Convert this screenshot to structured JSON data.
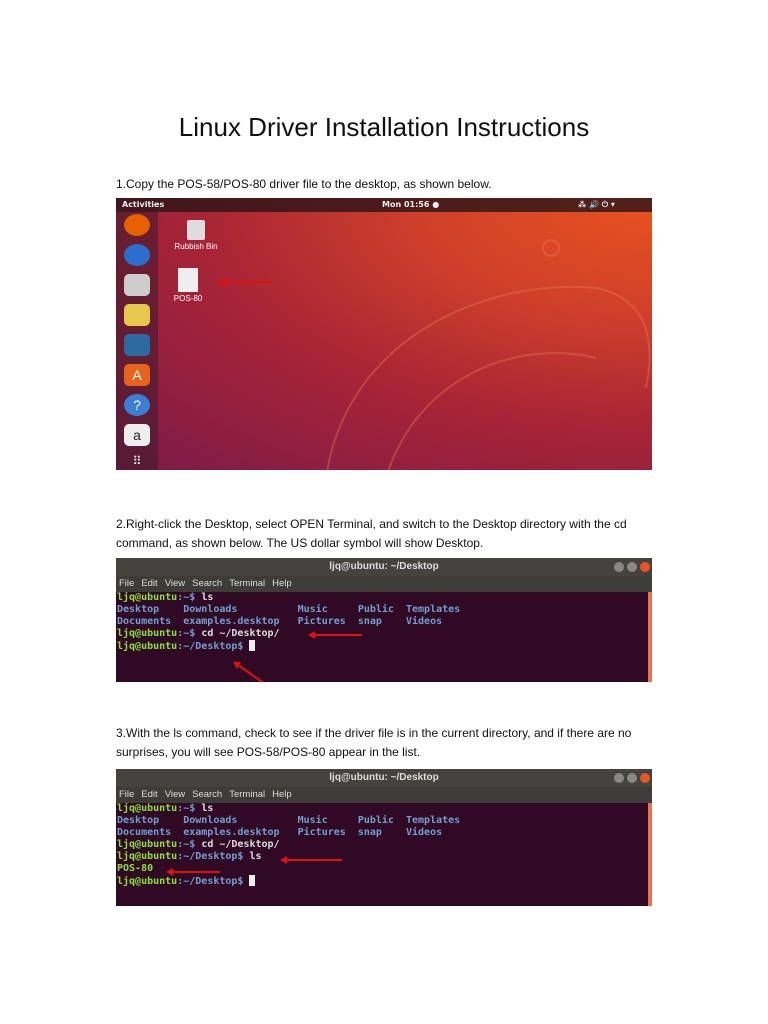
{
  "title": "Linux Driver Installation Instructions",
  "steps": [
    {
      "text": "1.Copy the POS-58/POS-80 driver file to the desktop, as shown below."
    },
    {
      "text": "2.Right-click the Desktop, select OPEN Terminal, and switch to the Desktop directory with the cd command, as shown below. The US dollar symbol will show Desktop."
    },
    {
      "text": "3.With the ls command, check to see if the driver file is in the current directory, and if there are no surprises, you will see POS-58/POS-80 appear in the list."
    }
  ],
  "desktop": {
    "activities": "Activities",
    "clock": "Mon 01:56 ●",
    "tray": "⁂ 🔊 ⏻ ▾",
    "rubbish_bin": "Rubbish Bin",
    "file": "POS-80",
    "dock": [
      "firefox-icon",
      "thunderbird-icon",
      "files-icon",
      "rhythmbox-icon",
      "writer-icon",
      "software-icon",
      "help-icon",
      "amazon-icon",
      "apps-grid-icon"
    ]
  },
  "terminal": {
    "title": "ljq@ubuntu: ~/Desktop",
    "menu": [
      "File",
      "Edit",
      "View",
      "Search",
      "Terminal",
      "Help"
    ],
    "prompt_home": "ljq@ubuntu",
    "home_suffix": ":~$ ",
    "desk_suffix": ":~/Desktop$ ",
    "cmd_ls": "ls",
    "cmd_cd": "cd ~/Desktop/",
    "ls_row1": "Desktop    Downloads          Music     Public  Templates",
    "ls_row2": "Documents  examples.desktop   Pictures  snap    Videos",
    "driver_file": "POS-80"
  },
  "colors": {
    "prompt": "#8ae234",
    "dir": "#729fcf",
    "bg": "#300a24",
    "arrow": "#e01010"
  }
}
